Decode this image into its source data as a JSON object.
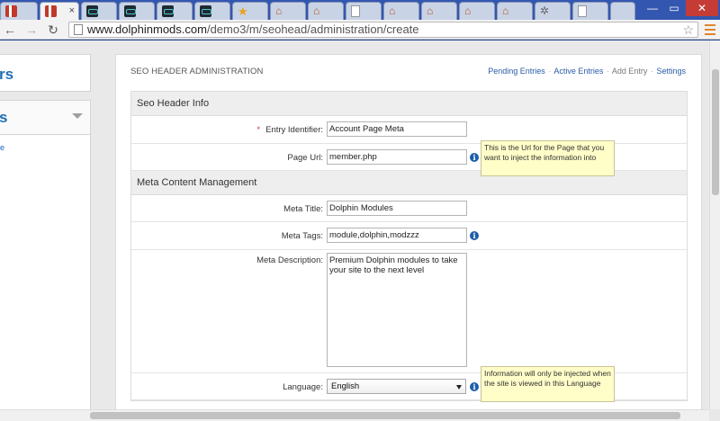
{
  "browser": {
    "tabs": [
      {
        "icon": "red-pause-icon",
        "active": false
      },
      {
        "icon": "red-pause-icon",
        "active": true
      },
      {
        "icon": "dolphin-icon",
        "active": false
      },
      {
        "icon": "dolphin-icon",
        "active": false
      },
      {
        "icon": "dolphin-icon",
        "active": false
      },
      {
        "icon": "dolphin-icon",
        "active": false
      },
      {
        "icon": "star-icon",
        "active": false
      },
      {
        "icon": "home-icon",
        "active": false
      },
      {
        "icon": "home-icon",
        "active": false
      },
      {
        "icon": "document-icon",
        "active": false
      },
      {
        "icon": "home-icon",
        "active": false
      },
      {
        "icon": "home-icon",
        "active": false
      },
      {
        "icon": "home-icon",
        "active": false
      },
      {
        "icon": "home-icon",
        "active": false
      },
      {
        "icon": "home-icon",
        "active": false
      },
      {
        "icon": "gear-icon",
        "active": false
      },
      {
        "icon": "document-icon",
        "active": false
      }
    ],
    "tab_close": "×",
    "window": {
      "minimize": "—",
      "maximize": "▭",
      "close": "✕"
    },
    "url_host": "www.dolphinmods.com",
    "url_path": "/demo3/m/seohead/administration/create",
    "nav": {
      "back": "←",
      "forward": "→",
      "reload": "↻"
    },
    "star": "☆"
  },
  "sidebar": {
    "title_fragment": "rs",
    "box2_title_fragment": "s",
    "link_fragment": "e"
  },
  "page": {
    "title": "SEO HEADER ADMINISTRATION",
    "links": {
      "pending": "Pending Entries",
      "active": "Active Entries",
      "add": "Add Entry",
      "settings": "Settings",
      "separator": "·"
    }
  },
  "form": {
    "section1": "Seo Header Info",
    "entry_identifier": {
      "required_mark": "*",
      "label": "Entry Identifier:",
      "value": "Account Page Meta"
    },
    "page_url": {
      "label": "Page Url:",
      "value": "member.php",
      "info": "i",
      "tooltip": "This is the Url for the Page that you want to inject the information into"
    },
    "section2": "Meta Content Management",
    "meta_title": {
      "label": "Meta Title:",
      "value": "Dolphin Modules"
    },
    "meta_tags": {
      "label": "Meta Tags:",
      "value": "module,dolphin,modzzz",
      "info": "i"
    },
    "meta_description": {
      "label": "Meta Description:",
      "value": "Premium Dolphin modules to take your site to the next level"
    },
    "language": {
      "label": "Language:",
      "selected": "English",
      "info": "i",
      "tooltip": "Information will only be injected when the site is viewed in this Language"
    }
  },
  "colors": {
    "frame": "#3356b0",
    "link": "#2a5ba8",
    "tooltip_bg": "#fffdc8",
    "info_icon": "#1e5ea8"
  }
}
